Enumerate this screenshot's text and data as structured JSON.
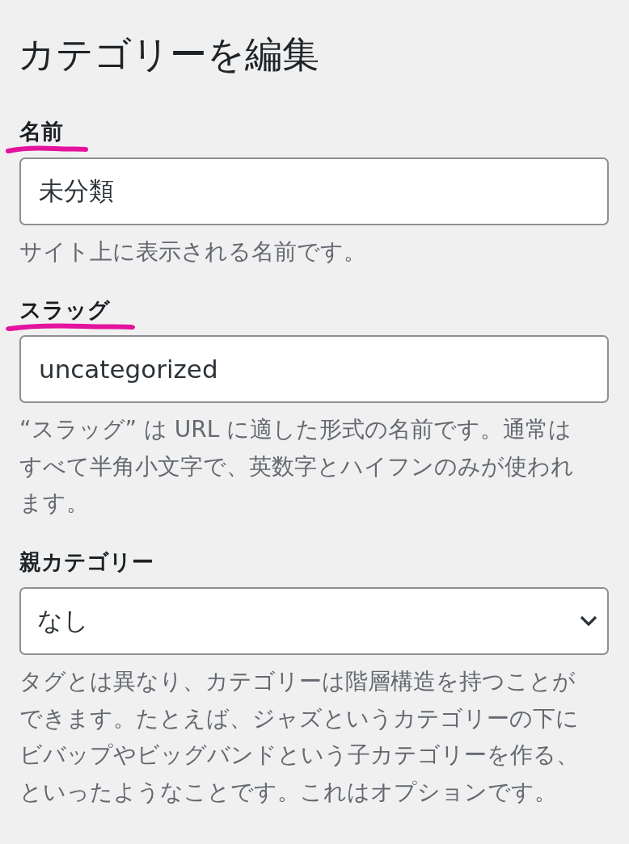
{
  "page": {
    "title": "カテゴリーを編集"
  },
  "fields": [
    {
      "kind": "text",
      "label": "名前",
      "value": "未分類",
      "help": "サイト上に表示される名前です。",
      "underlined": true
    },
    {
      "kind": "text",
      "label": "スラッグ",
      "value": "uncategorized",
      "help": "“スラッグ” は URL に適した形式の名前です。通常はすべて半角小文字で、英数字とハイフンのみが使われます。",
      "underlined": true
    },
    {
      "kind": "select",
      "label": "親カテゴリー",
      "value": "なし",
      "help": "タグとは異なり、カテゴリーは階層構造を持つことができます。たとえば、ジャズというカテゴリーの下にビバップやビッグバンドという子カテゴリーを作る、といったようなことです。これはオプションです。",
      "underlined": false
    }
  ]
}
